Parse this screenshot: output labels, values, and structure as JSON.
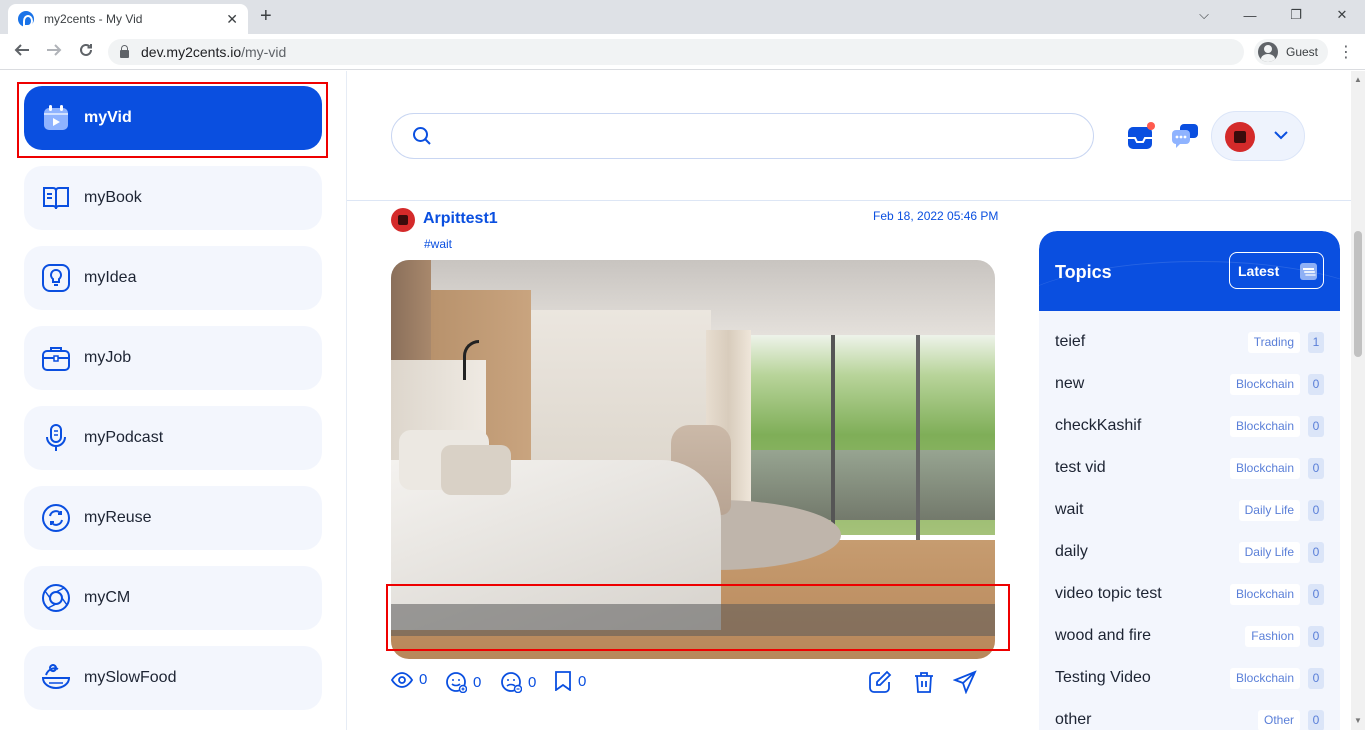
{
  "browser": {
    "tab_title": "my2cents - My Vid",
    "close_glyph": "✕",
    "new_tab_glyph": "+",
    "url_host": "dev.my2cents.io",
    "url_path": "/my-vid",
    "profile_label": "Guest",
    "window_controls": [
      "⌵",
      "—",
      "❐",
      "✕"
    ]
  },
  "sidebar": {
    "items": [
      {
        "label": "myVid",
        "icon": "video-calendar-icon",
        "active": true
      },
      {
        "label": "myBook",
        "icon": "book-icon"
      },
      {
        "label": "myIdea",
        "icon": "lightbulb-icon"
      },
      {
        "label": "myJob",
        "icon": "briefcase-icon"
      },
      {
        "label": "myPodcast",
        "icon": "microphone-icon"
      },
      {
        "label": "myReuse",
        "icon": "recycle-icon"
      },
      {
        "label": "myCM",
        "icon": "aperture-icon"
      },
      {
        "label": "mySlowFood",
        "icon": "food-bowl-icon"
      }
    ]
  },
  "header": {
    "search_placeholder": "",
    "notification_dot": true
  },
  "post": {
    "username": "Arpittest1",
    "date": "Feb 18, 2022 05:46 PM",
    "tag": "#wait",
    "stats": {
      "views": "0",
      "likes": "0",
      "dislikes": "0",
      "bookmarks": "0"
    }
  },
  "topics": {
    "title": "Topics",
    "sort_label": "Latest",
    "items": [
      {
        "name": "teief",
        "category": "Trading",
        "count": "1"
      },
      {
        "name": "new",
        "category": "Blockchain",
        "count": "0"
      },
      {
        "name": "checkKashif",
        "category": "Blockchain",
        "count": "0"
      },
      {
        "name": "test vid",
        "category": "Blockchain",
        "count": "0"
      },
      {
        "name": "wait",
        "category": "Daily Life",
        "count": "0"
      },
      {
        "name": "daily",
        "category": "Daily Life",
        "count": "0"
      },
      {
        "name": "video topic test",
        "category": "Blockchain",
        "count": "0"
      },
      {
        "name": "wood and fire",
        "category": "Fashion",
        "count": "0"
      },
      {
        "name": "Testing Video",
        "category": "Blockchain",
        "count": "0"
      },
      {
        "name": "other",
        "category": "Other",
        "count": "0"
      }
    ]
  },
  "colors": {
    "primary": "#0a4fe0",
    "highlight": "#e00000",
    "panel_bg": "#f3f6fd"
  }
}
